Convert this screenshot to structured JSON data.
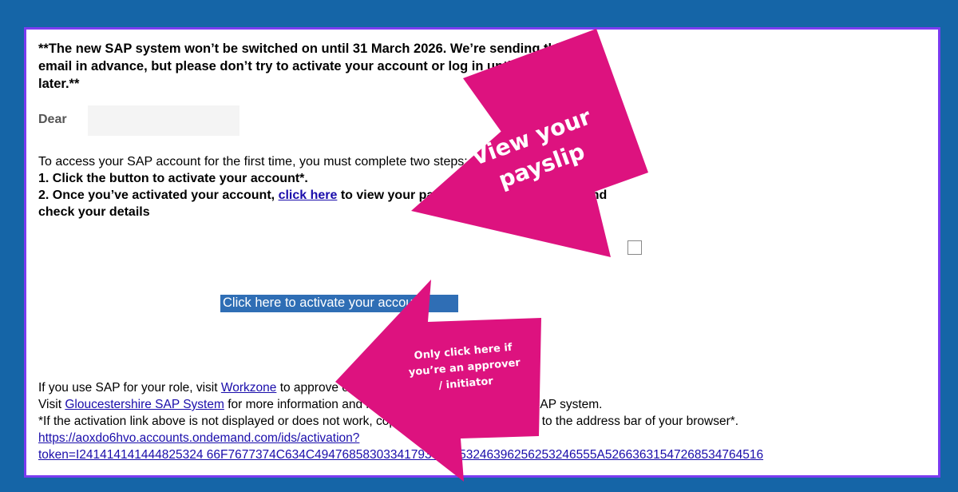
{
  "email": {
    "warning": "**The new SAP system won’t be switched on until 31 March 2026. We’re sending this email in advance, but please don’t try to activate your account or log in until 31 March or later.**",
    "greeting": "Dear",
    "intro": "To access your SAP account for the first time, you must complete two steps:",
    "step1": "1. Click the button to activate your account*.",
    "step2_before": "2. Once you’ve activated your account,",
    "step2_link": "click here",
    "step2_after": "to view your payslip, book annual leave and check your details",
    "activate_button": "Click here to activate your account",
    "workzone_before": "If you use SAP for your role, visit",
    "workzone_link": "Workzone",
    "workzone_after": "to approve or initiate actions.",
    "visit_before": "Visit",
    "visit_link": "Gloucestershire SAP System",
    "visit_after": "for more information and help with logging into the new SAP system.",
    "fallback": "*If the activation link above is not displayed or does not work, copy and paste the link below to the address bar of your browser*.",
    "activation_url_line1": "https://aoxdo6hvo.accounts.ondemand.com/ids/activation?",
    "activation_url_line2": "token=I241414141444825324 66F7677374C634C49476858303341793673253246396256253246555A52663631547268534764516"
  },
  "callouts": {
    "payslip_line1": "View your",
    "payslip_line2": "payslip",
    "approver_line1": "Only click here if",
    "approver_line2": "you’re an approver",
    "approver_line3": "/ initiator"
  },
  "colors": {
    "background": "#1565a7",
    "frame_border": "#7a3cf0",
    "callout": "#dd127f",
    "button": "#2f6eb5"
  }
}
